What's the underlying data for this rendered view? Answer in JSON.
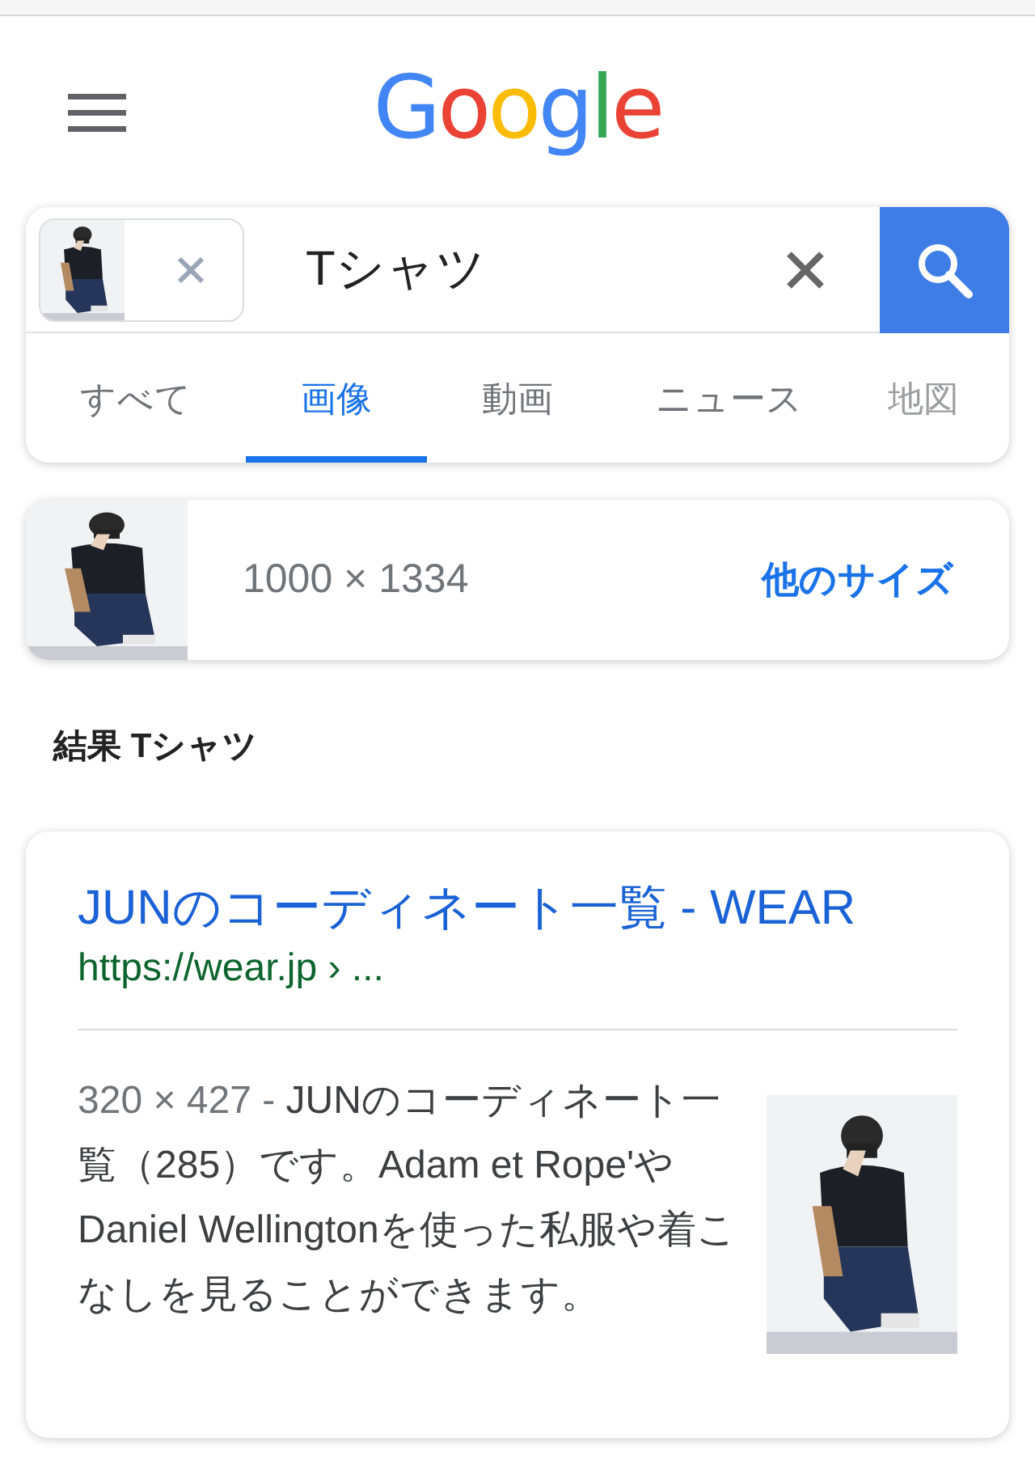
{
  "header": {
    "logo": "Google"
  },
  "search": {
    "value": "Tシャツ"
  },
  "tabs": [
    {
      "label": "すべて",
      "selected": false
    },
    {
      "label": "画像",
      "selected": true
    },
    {
      "label": "動画",
      "selected": false
    },
    {
      "label": "ニュース",
      "selected": false
    },
    {
      "label": "地図",
      "selected": false
    }
  ],
  "image_info": {
    "dimensions": "1000 × 1334",
    "more_sizes": "他のサイズ"
  },
  "results_heading": "結果 Tシャツ",
  "result": {
    "title": "JUNのコーディネート一覧 - WEAR",
    "url": "https://wear.jp › ...",
    "size": "320 × 427 - ",
    "snippet": "JUNのコーディネート一覧（285）です。Adam et Rope'やDaniel Wellingtonを使った私服や着こなしを見ることができます。"
  }
}
